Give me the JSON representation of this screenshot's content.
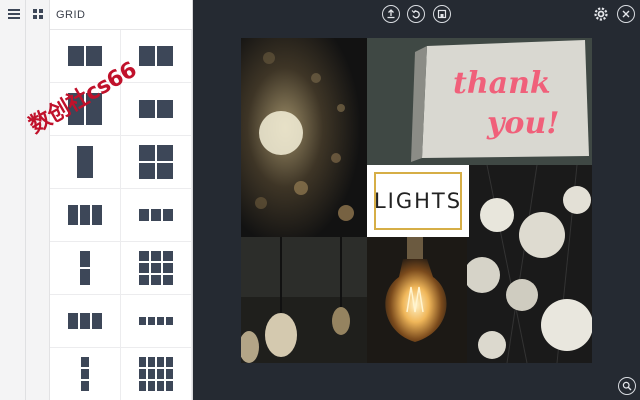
{
  "sidebar": {
    "menu_icon": "hamburger-menu-icon",
    "grid_icon": "grid-icon"
  },
  "panel": {
    "title": "GRID",
    "layouts": [
      "two-column",
      "two-column-wide",
      "two-column-tall",
      "two-column-short",
      "two-column-offset",
      "four-grid",
      "three-column",
      "three-column-short",
      "two-row-narrow",
      "nine-grid",
      "three-column-wide",
      "four-column",
      "three-row-narrow",
      "twelve-grid"
    ]
  },
  "watermark": "数创社cs66",
  "toolbar": {
    "upload_icon": "upload-icon",
    "undo_icon": "undo-icon",
    "save_icon": "save-icon",
    "settings_icon": "gear-icon",
    "close_icon": "close-icon",
    "zoom_icon": "zoom-icon"
  },
  "collage": {
    "text_card": "LIGHTS",
    "neon_sign_text": "thank you!",
    "accent_color": "#d6ae46",
    "neon_color": "#f0607a",
    "workspace_color": "#252a32"
  }
}
